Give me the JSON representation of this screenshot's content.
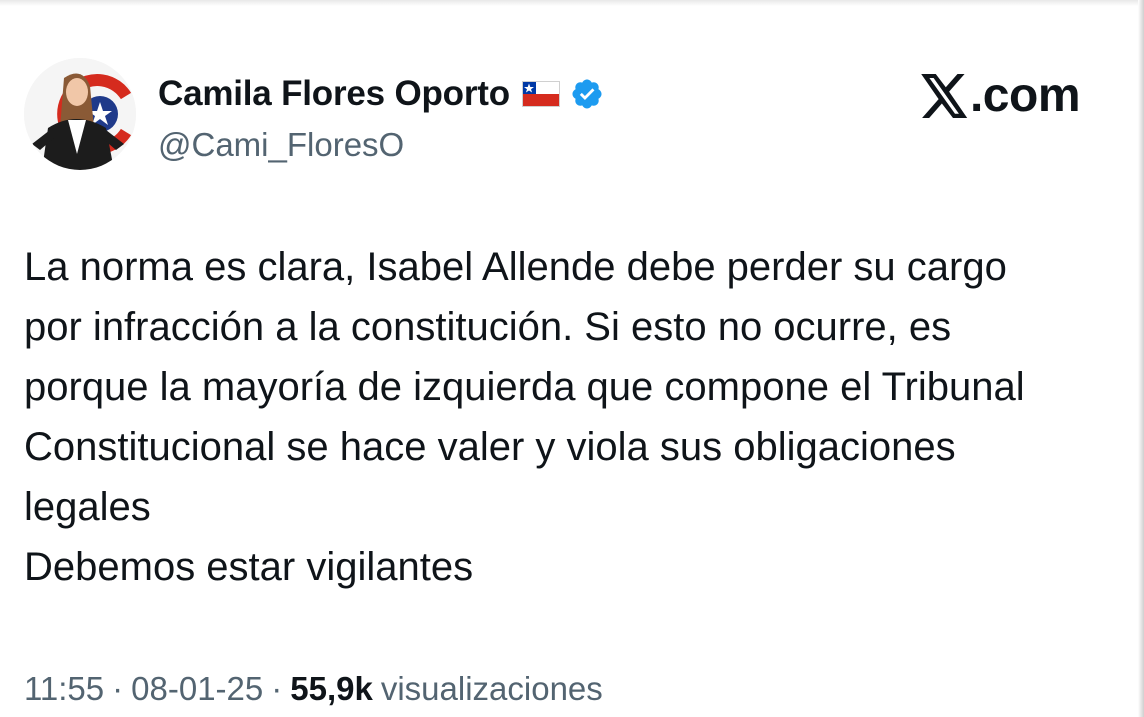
{
  "author": {
    "display_name": "Camila Flores Oporto",
    "handle": "@Cami_FloresO",
    "flag_icon": "chile-flag-icon",
    "verified_icon": "verified-badge-icon"
  },
  "brand": {
    "icon": "x-logo-icon",
    "text": ".com"
  },
  "tweet": {
    "lines": [
      "La norma es clara, Isabel Allende debe perder su cargo",
      "por infracción a la constitución. Si esto no ocurre, es",
      "porque la mayoría de izquierda que compone el Tribunal",
      "Constitucional se hace valer y viola sus obligaciones",
      "legales",
      "Debemos estar vigilantes"
    ]
  },
  "meta": {
    "time": "11:55",
    "separator": "·",
    "date": "08-01-25",
    "views_count": "55,9k",
    "views_label": "visualizaciones"
  },
  "colors": {
    "text_primary": "#0f1419",
    "text_secondary": "#536471",
    "verified_blue": "#1d9bf0",
    "avatar_logo_red": "#d52b1e",
    "avatar_logo_blue": "#1f3a8a"
  }
}
